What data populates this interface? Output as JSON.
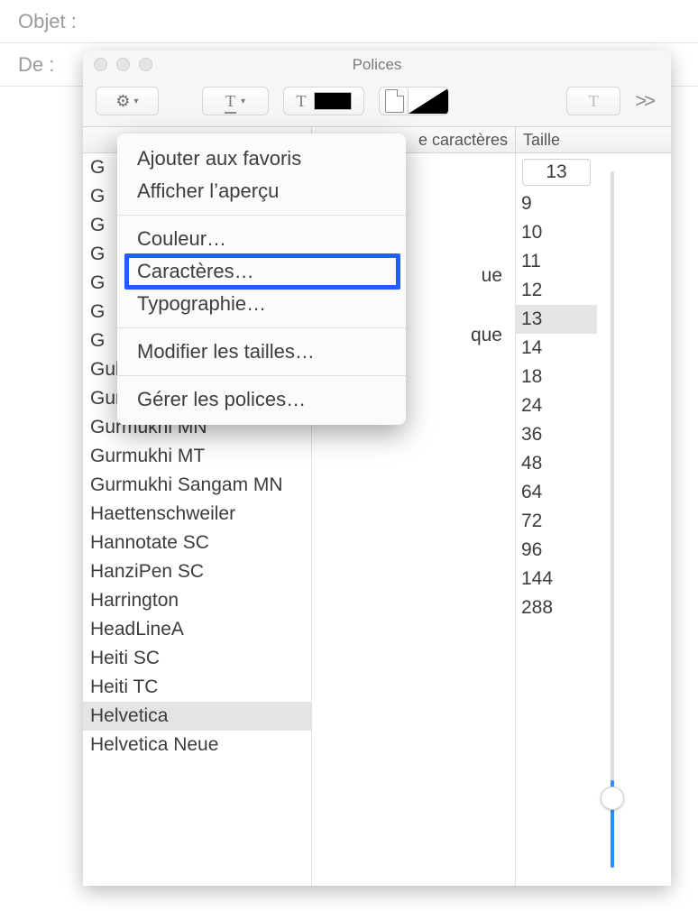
{
  "compose": {
    "subject_label": "Objet :",
    "from_label": "De :"
  },
  "panel": {
    "title": "Polices",
    "overflow_glyph": ">>",
    "columns": {
      "families_label": "",
      "styles_label_partial": "e caractères",
      "sizes_label": "Taille"
    },
    "families": [
      "G",
      "G",
      "G",
      "G",
      "G",
      "G",
      "G",
      "Gulim",
      "GungSeo",
      "Gurmukhi MN",
      "Gurmukhi MT",
      "Gurmukhi Sangam MN",
      "Haettenschweiler",
      "Hannotate SC",
      "HanziPen SC",
      "Harrington",
      "HeadLineA",
      "Heiti SC",
      "Heiti TC",
      "Helvetica",
      "Helvetica Neue"
    ],
    "selected_family_index": 19,
    "visible_styles": [
      "ue",
      "que"
    ],
    "size_input_value": "13",
    "sizes": [
      "9",
      "10",
      "11",
      "12",
      "13",
      "14",
      "18",
      "24",
      "36",
      "48",
      "64",
      "72",
      "96",
      "144",
      "288"
    ],
    "selected_size_index": 4,
    "slider_fill_pct": 12,
    "slider_thumb_pct": 88
  },
  "gear_menu": {
    "items": [
      {
        "label": "Ajouter aux favoris",
        "sep_after": false
      },
      {
        "label": "Afficher l’aperçu",
        "sep_after": true
      },
      {
        "label": "Couleur…",
        "sep_after": false
      },
      {
        "label": "Caractères…",
        "sep_after": false,
        "highlighted": true
      },
      {
        "label": "Typographie…",
        "sep_after": true
      },
      {
        "label": "Modifier les tailles…",
        "sep_after": true
      },
      {
        "label": "Gérer les polices…",
        "sep_after": false
      }
    ]
  },
  "icons": {
    "gear": "⚙",
    "chev_down": "▾"
  }
}
